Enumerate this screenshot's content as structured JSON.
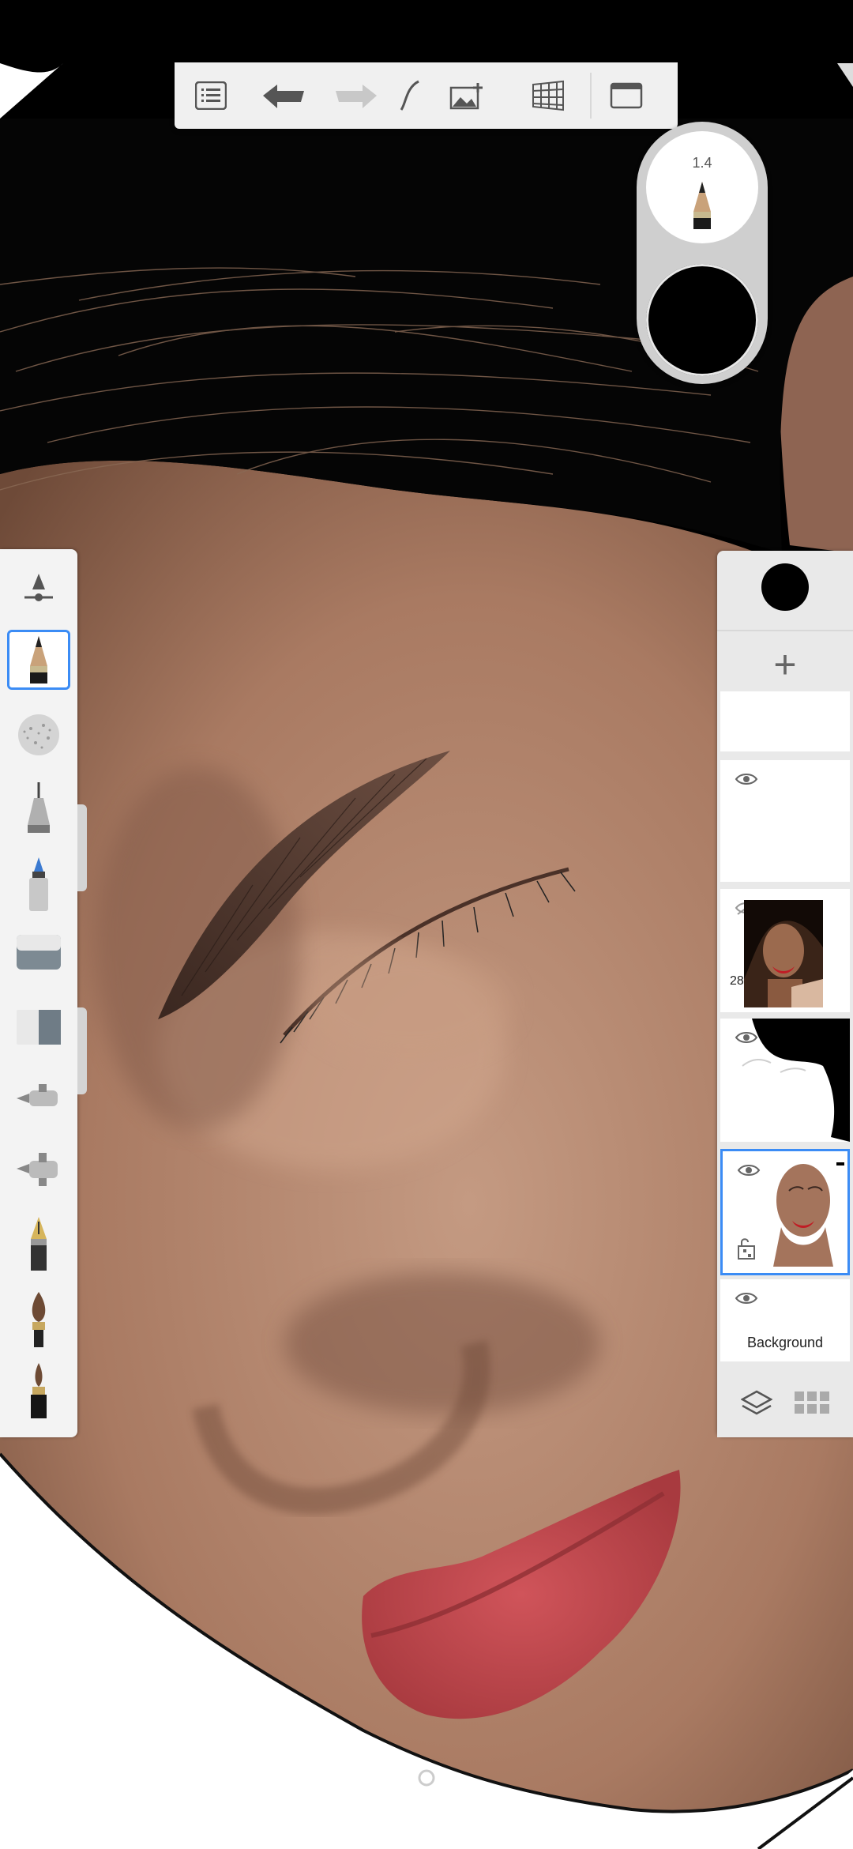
{
  "app": {
    "canvas": {
      "description_hidden": true
    },
    "toolbar": {
      "items": [
        "list-icon",
        "undo-icon",
        "redo-icon",
        "stroke-stabilizer-icon",
        "add-image-icon",
        "perspective-guide-icon",
        "fullscreen-icon"
      ]
    },
    "brush_puck": {
      "size": "1.4",
      "color": "#000000"
    },
    "brush_palette": {
      "tools": [
        "brush-properties-icon",
        "pencil-icon",
        "airbrush-texture-icon",
        "technical-pen-icon",
        "marker-icon",
        "hard-eraser-icon",
        "soft-eraser-icon",
        "airbrush-icon",
        "airbrush-alt-icon",
        "fountain-pen-icon",
        "paint-brush-icon",
        "ink-brush-icon"
      ],
      "selected": "pencil-icon"
    },
    "layers": {
      "color_swatch": "#000000",
      "add_label": "+",
      "items": [
        {
          "name": "layer-empty-top",
          "visible": false
        },
        {
          "name": "layer-empty",
          "visible": true
        },
        {
          "name": "layer-reference-photo",
          "visible": false,
          "opacity_label": "28"
        },
        {
          "name": "layer-hair-mask",
          "visible": true
        },
        {
          "name": "layer-painting",
          "visible": true,
          "selected": true
        },
        {
          "name": "layer-background",
          "visible": true,
          "label": "Background"
        }
      ]
    },
    "colors": {
      "accent": "#3b8cf5",
      "lips": "#c6474b",
      "skin": "#b98a72"
    }
  }
}
